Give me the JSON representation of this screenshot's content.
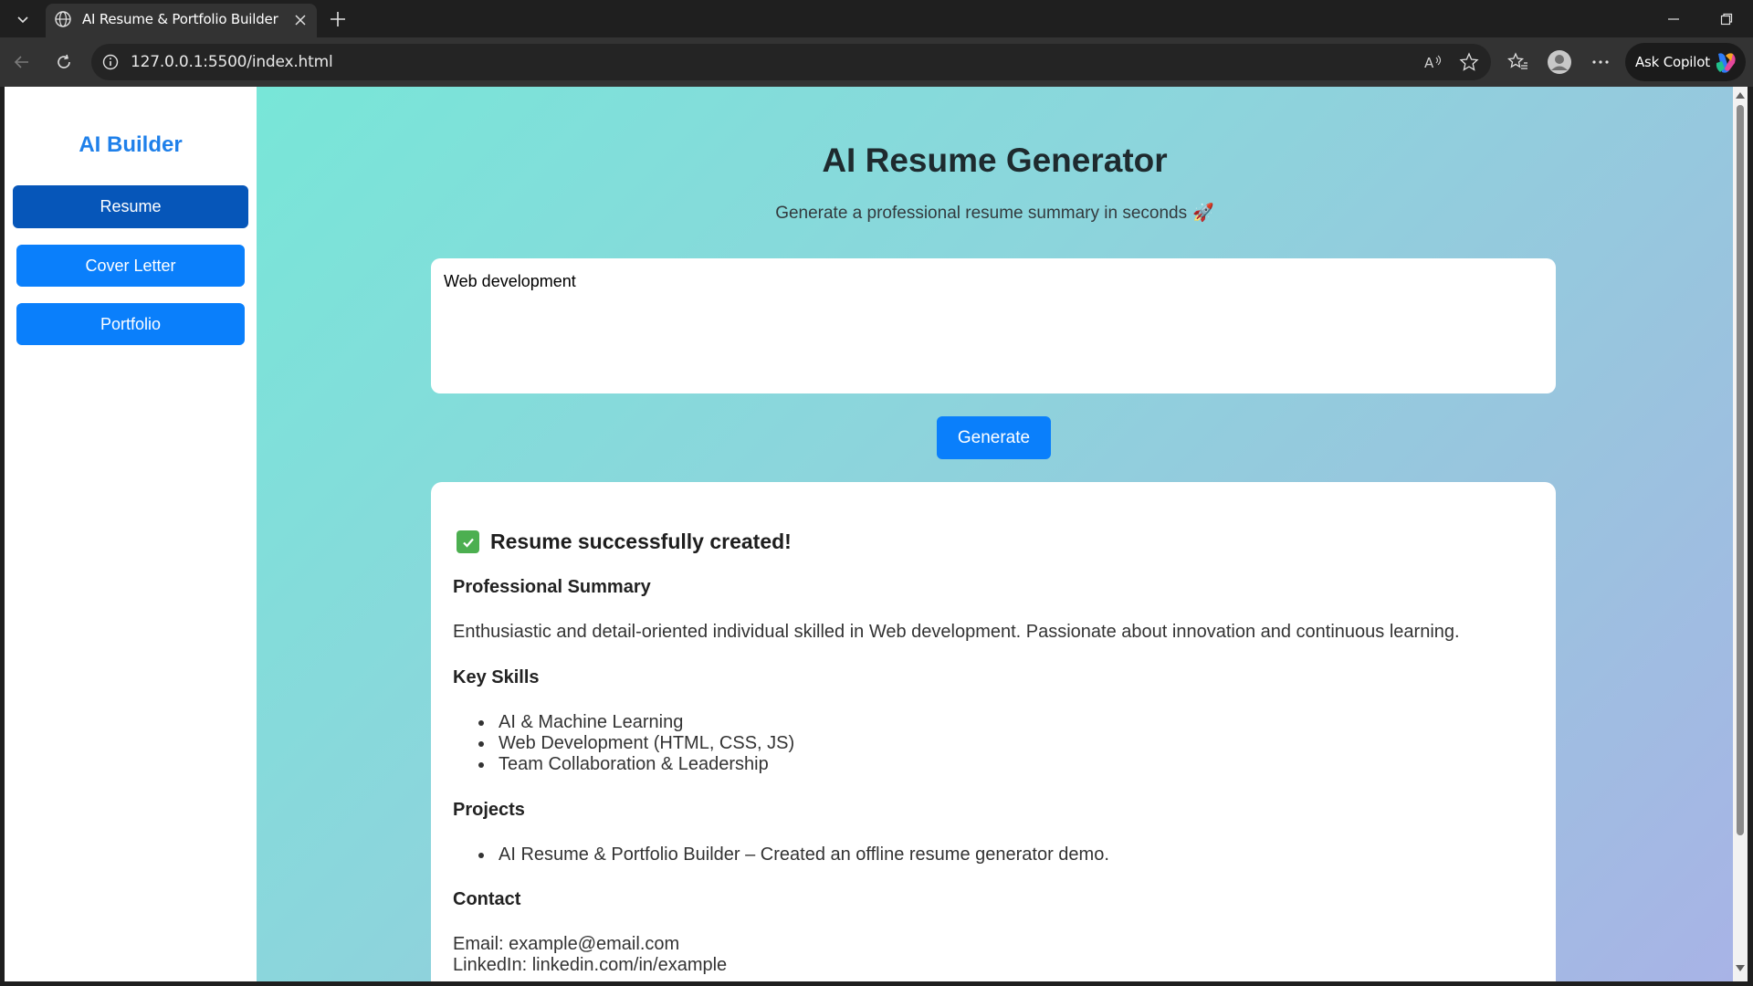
{
  "browser": {
    "tab_title": "AI Resume & Portfolio Builder",
    "url": "127.0.0.1:5500/index.html",
    "copilot_label": "Ask Copilot"
  },
  "sidebar": {
    "title": "AI Builder",
    "items": [
      {
        "label": "Resume",
        "active": true
      },
      {
        "label": "Cover Letter",
        "active": false
      },
      {
        "label": "Portfolio",
        "active": false
      }
    ]
  },
  "main": {
    "title": "AI Resume Generator",
    "subtitle": "Generate a professional resume summary in seconds",
    "subtitle_emoji": "🚀",
    "prompt_value": "Web development",
    "generate_label": "Generate"
  },
  "result": {
    "status": "Resume successfully created!",
    "summary_heading": "Professional Summary",
    "summary_text": "Enthusiastic and detail-oriented individual skilled in Web development. Passionate about innovation and continuous learning.",
    "skills_heading": "Key Skills",
    "skills": [
      "AI & Machine Learning",
      "Web Development (HTML, CSS, JS)",
      "Team Collaboration & Leadership"
    ],
    "projects_heading": "Projects",
    "projects": [
      "AI Resume & Portfolio Builder – Created an offline resume generator demo."
    ],
    "contact_heading": "Contact",
    "email": "Email: example@email.com",
    "linkedin": "LinkedIn: linkedin.com/in/example"
  },
  "colors": {
    "accent": "#0a7ffb",
    "accent_active": "#0656b9",
    "sidebar_title": "#1f80ea",
    "success": "#4caf50"
  }
}
